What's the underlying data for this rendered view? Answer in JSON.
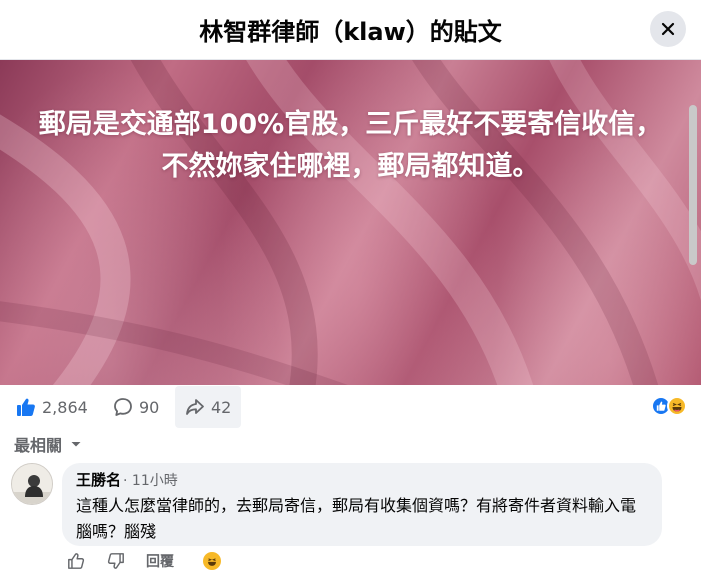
{
  "header": {
    "title": "林智群律師（klaw）的貼文",
    "close_icon": "close-icon"
  },
  "post": {
    "image_text": "郵局是交通部100%官股，三斤最好不要寄信收信，不然妳家住哪裡，郵局都知道。",
    "background": "pink-silk-fabric",
    "colors": {
      "text": "#ffffff",
      "fabric": "#b45d78"
    }
  },
  "stats": {
    "likes": "2,864",
    "comments": "90",
    "shares": "42",
    "icons": [
      "like-icon",
      "comment-icon",
      "share-icon"
    ],
    "reactions": [
      "like-reaction",
      "haha-reaction"
    ]
  },
  "sort": {
    "label": "最相關"
  },
  "comment": {
    "author": "王勝名",
    "time": "· 11小時",
    "text": "這種人怎麼當律師的，去郵局寄信，郵局有收集個資嗎？有將寄件者資料輸入電腦嗎？腦殘",
    "reply_label": "回覆",
    "icons": [
      "like-icon",
      "dislike-icon",
      "emoji-icon"
    ]
  },
  "colors": {
    "accent": "#1877f2",
    "secondary_text": "#65676b",
    "bubble": "#f0f2f5"
  }
}
